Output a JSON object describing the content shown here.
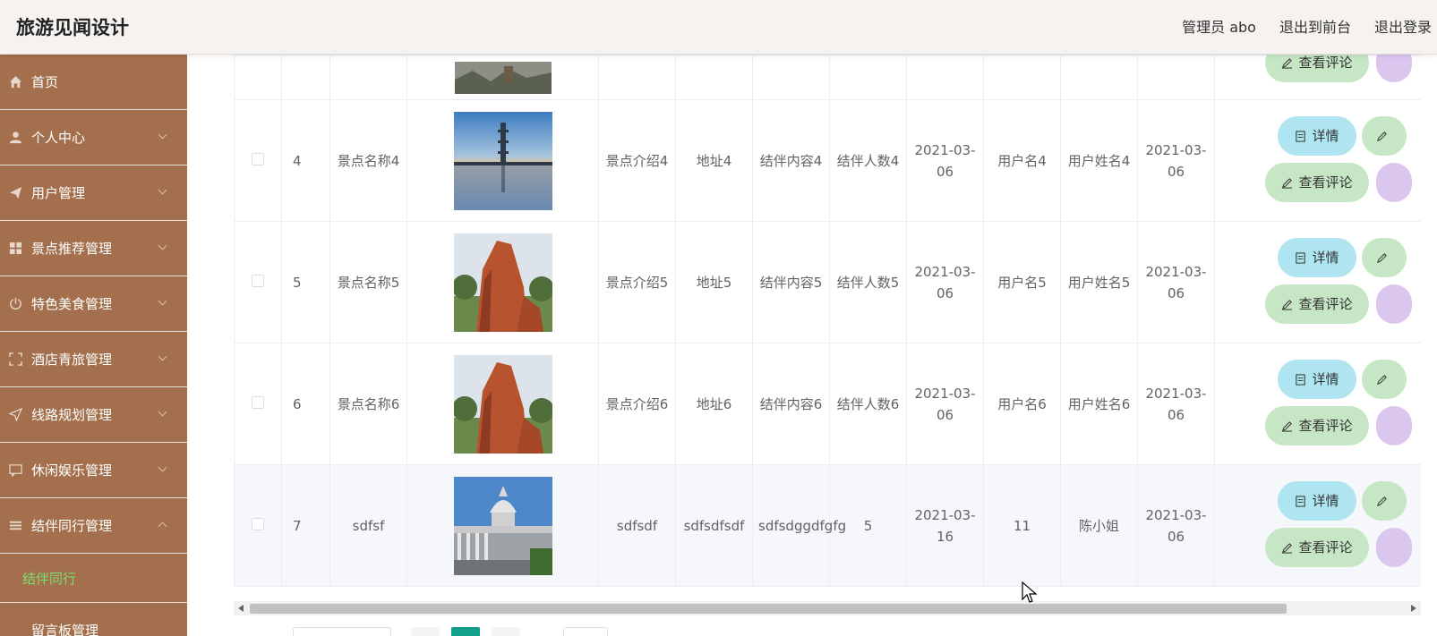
{
  "header": {
    "title": "旅游见闻设计",
    "nav": [
      "管理员 abo",
      "退出到前台",
      "退出登录"
    ]
  },
  "sidebar": {
    "items": [
      {
        "label": "首页",
        "icon": "home-icon",
        "expandable": false
      },
      {
        "label": "个人中心",
        "icon": "user-icon",
        "expandable": true
      },
      {
        "label": "用户管理",
        "icon": "send-icon",
        "expandable": true
      },
      {
        "label": "景点推荐管理",
        "icon": "grid-icon",
        "expandable": true
      },
      {
        "label": "特色美食管理",
        "icon": "power-icon",
        "expandable": true
      },
      {
        "label": "酒店青旅管理",
        "icon": "frame-icon",
        "expandable": true
      },
      {
        "label": "线路规划管理",
        "icon": "navigation-icon",
        "expandable": true
      },
      {
        "label": "休闲娱乐管理",
        "icon": "chat-icon",
        "expandable": true
      },
      {
        "label": "结伴同行管理",
        "icon": "menu-icon",
        "expandable": true,
        "open": true
      }
    ],
    "submenu_label": "结伴同行",
    "last_item_partial": "留言板管理"
  },
  "table": {
    "rows": [
      {
        "index": "4",
        "name": "景点名称4",
        "intro": "景点介绍4",
        "address": "地址4",
        "content": "结伴内容4",
        "count": "结伴人数4",
        "date1": "2021-03-06",
        "username": "用户名4",
        "realname": "用户姓名4",
        "date2": "2021-03-06",
        "image": "pagoda-lake"
      },
      {
        "index": "5",
        "name": "景点名称5",
        "intro": "景点介绍5",
        "address": "地址5",
        "content": "结伴内容5",
        "count": "结伴人数5",
        "date1": "2021-03-06",
        "username": "用户名5",
        "realname": "用户姓名5",
        "date2": "2021-03-06",
        "image": "red-rock"
      },
      {
        "index": "6",
        "name": "景点名称6",
        "intro": "景点介绍6",
        "address": "地址6",
        "content": "结伴内容6",
        "count": "结伴人数6",
        "date1": "2021-03-06",
        "username": "用户名6",
        "realname": "用户姓名6",
        "date2": "2021-03-06",
        "image": "red-rock"
      },
      {
        "index": "7",
        "name": "sdfsf",
        "intro": "sdfsdf",
        "address": "sdfsdfsdf",
        "content": "sdfsdggdfgfg",
        "count": "5",
        "date1": "2021-03-16",
        "username": "11",
        "realname": "陈小姐",
        "date2": "2021-03-06",
        "image": "capitol"
      }
    ],
    "actions": {
      "detail": "详情",
      "review": "查看评论"
    }
  },
  "colors": {
    "sidebar_bg": "#a36f4d",
    "submenu_active": "#7dde6e",
    "detail_btn": "#aee5f0",
    "review_btn": "#c6e6c5",
    "purple_btn": "#dbc6ee",
    "pager_active": "#12a08a"
  }
}
